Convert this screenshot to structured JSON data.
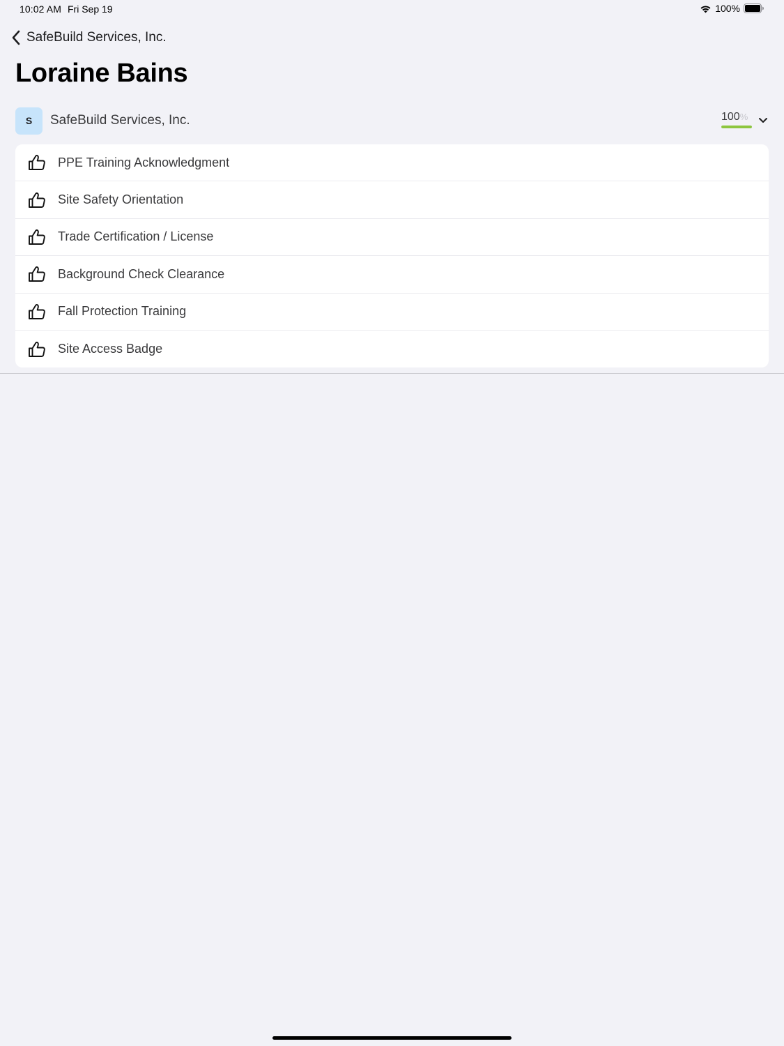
{
  "status_bar": {
    "time": "10:02 AM",
    "date": "Fri Sep 19",
    "battery": "100%"
  },
  "nav": {
    "back_label": "SafeBuild Services, Inc.",
    "title": "Loraine Bains"
  },
  "company": {
    "avatar_initial": "S",
    "name": "SafeBuild Services, Inc.",
    "progress_value": "100",
    "progress_unit": "%",
    "progress_fraction": 1.0,
    "accent_color": "#8dc63f",
    "avatar_color": "#c7e4fb"
  },
  "requirements": [
    {
      "label": "PPE Training Acknowledgment",
      "icon": "thumbs-up-icon"
    },
    {
      "label": "Site Safety Orientation",
      "icon": "thumbs-up-icon"
    },
    {
      "label": "Trade Certification / License",
      "icon": "thumbs-up-icon"
    },
    {
      "label": "Background Check Clearance",
      "icon": "thumbs-up-icon"
    },
    {
      "label": "Fall Protection Training",
      "icon": "thumbs-up-icon"
    },
    {
      "label": "Site Access Badge",
      "icon": "thumbs-up-icon"
    }
  ]
}
